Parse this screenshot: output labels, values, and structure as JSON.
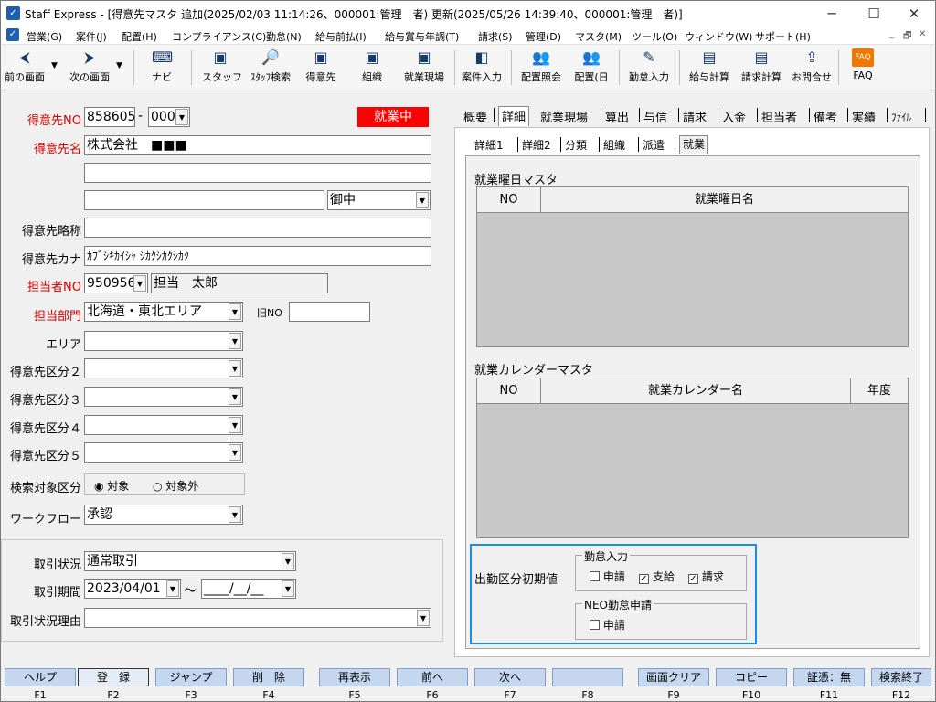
{
  "window": {
    "title": "Staff Express - [得意先マスタ 追加(2025/02/03 11:14:26、000001:管理　者) 更新(2025/05/26 14:39:40、000001:管理　者)]",
    "minimize": "─",
    "maximize": "☐",
    "close": "✕"
  },
  "menu": [
    "営業(G)",
    "案件(J)",
    "配置(H)",
    "コンプライアンス(C)",
    "勤怠(N)",
    "給与前払(I)",
    "給与賞与年調(T)",
    "請求(S)",
    "管理(D)",
    "マスタ(M)",
    "ツール(O)",
    "ウィンドウ(W)",
    "サポート(H)"
  ],
  "mdi_controls": [
    "_",
    "🗗",
    "✕"
  ],
  "toolbar": {
    "prev": "前の画面",
    "next": "次の画面",
    "navi": "ナビ",
    "staff": "スタッフ",
    "staff_search": "ｽﾀｯﾌ検索",
    "customer": "得意先",
    "org": "組織",
    "site": "就業現場",
    "case": "案件入力",
    "assign": "配置照会",
    "assign_day": "配置(日",
    "attendance": "勤怠入力",
    "payroll": "給与計算",
    "billing": "請求計算",
    "contact": "お問合せ",
    "faq": "FAQ"
  },
  "form": {
    "cust_no_label": "得意先NO",
    "cust_no": "858605",
    "cust_no_dash": "-",
    "cust_branch": "000",
    "status_badge": "就業中",
    "cust_name_label": "得意先名",
    "cust_name": "株式会社　■■■",
    "cust_name2": "",
    "cust_name3": "",
    "honorific": "御中",
    "abbr_label": "得意先略称",
    "abbr": "",
    "kana_label": "得意先カナ",
    "kana": "ｶﾌﾞｼｷｶｲｼｬ ｼｶｸｼｶｸｼｶｸ",
    "rep_no_label": "担当者NO",
    "rep_no": "950956",
    "rep_name": "担当　太郎",
    "dept_label": "担当部門",
    "dept": "北海道・東北エリア",
    "old_no_label": "旧NO",
    "old_no": "",
    "area_label": "エリア",
    "area": "",
    "class2_label": "得意先区分２",
    "class2": "",
    "class3_label": "得意先区分３",
    "class3": "",
    "class4_label": "得意先区分４",
    "class4": "",
    "class5_label": "得意先区分５",
    "class5": "",
    "search_label": "検索対象区分",
    "search_opt1": "対象",
    "search_opt2": "対象外",
    "workflow_label": "ワークフロー",
    "workflow": "承認",
    "trade_status_label": "取引状況",
    "trade_status": "通常取引",
    "trade_period_label": "取引期間",
    "trade_from": "2023/04/01",
    "tilde": "～",
    "trade_to": "____/__/__",
    "trade_reason_label": "取引状況理由",
    "trade_reason": ""
  },
  "tabs_main": [
    "概要",
    "詳細",
    "就業現場",
    "算出",
    "与信",
    "請求",
    "入金",
    "担当者",
    "備考",
    "実績",
    "ﾌｧｲﾙ"
  ],
  "tabs_sub": [
    "詳細1",
    "詳細2",
    "分類",
    "組織",
    "派遣",
    "就業"
  ],
  "weekday_grid": {
    "title": "就業曜日マスタ",
    "col_no": "NO",
    "col_name": "就業曜日名"
  },
  "calendar_grid": {
    "title": "就業カレンダーマスタ",
    "col_no": "NO",
    "col_name": "就業カレンダー名",
    "col_year": "年度"
  },
  "defaults": {
    "label": "出勤区分初期値",
    "group1": "勤怠入力",
    "opt_apply": "申請",
    "opt_pay": "支給",
    "opt_bill": "請求",
    "group2": "NEO勤怠申請",
    "opt_neo": "申請",
    "check": "✓"
  },
  "fkeys": [
    {
      "label": "ヘルプ",
      "key": "F1"
    },
    {
      "label": "登　録",
      "key": "F2"
    },
    {
      "label": "ジャンプ",
      "key": "F3"
    },
    {
      "label": "削　除",
      "key": "F4"
    },
    {
      "label": "再表示",
      "key": "F5"
    },
    {
      "label": "前へ",
      "key": "F6"
    },
    {
      "label": "次へ",
      "key": "F7"
    },
    {
      "label": "",
      "key": "F8"
    },
    {
      "label": "画面クリア",
      "key": "F9"
    },
    {
      "label": "コピー",
      "key": "F10"
    },
    {
      "label": "証憑：無",
      "key": "F11"
    },
    {
      "label": "検索終了",
      "key": "F12"
    }
  ],
  "colors": {
    "required": "#d40000",
    "badge": "#ff0000",
    "highlight": "#1a8fe0",
    "fkey": "#c5d7ee"
  }
}
